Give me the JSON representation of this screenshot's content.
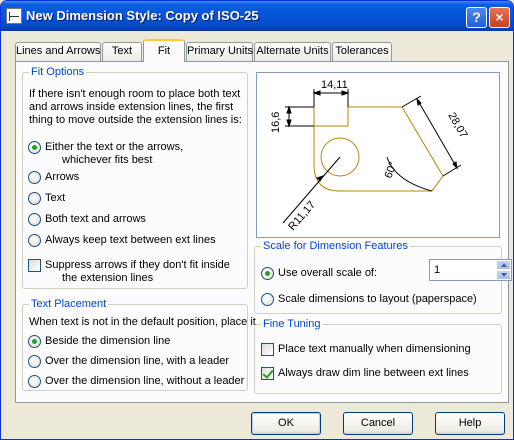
{
  "window": {
    "title": "New Dimension Style: Copy of ISO-25",
    "help_glyph": "?",
    "close_glyph": "×"
  },
  "tabs": [
    {
      "label": "Lines and Arrows"
    },
    {
      "label": "Text"
    },
    {
      "label": "Fit",
      "active": true
    },
    {
      "label": "Primary Units"
    },
    {
      "label": "Alternate Units"
    },
    {
      "label": "Tolerances"
    }
  ],
  "fit_options": {
    "title": "Fit Options",
    "description": [
      "If there isn't enough room to place both text",
      "and arrows inside extension lines, the first",
      "thing to move outside the extension lines is:"
    ],
    "either_label_1": "Either the text or the arrows,",
    "either_label_2": "whichever fits best",
    "arrows_label": "Arrows",
    "text_label": "Text",
    "both_label": "Both text and arrows",
    "always_keep_label": "Always keep text between ext lines",
    "suppress_label_1": "Suppress arrows if they don't fit inside",
    "suppress_label_2": "the extension lines",
    "selected": "either"
  },
  "text_placement": {
    "title": "Text Placement",
    "description": "When text is not in the default position, place it",
    "beside_label": "Beside the dimension line",
    "over_leader_label": "Over the dimension line, with a leader",
    "over_no_leader_label": "Over the dimension line, without a leader",
    "selected": "beside"
  },
  "preview": {
    "dim_top": "14,11",
    "dim_left": "16,6",
    "dim_right": "28,07",
    "dim_angle": "60°",
    "dim_radius": "R11,17",
    "geometry_color": "#b8860b"
  },
  "scale": {
    "title": "Scale for Dimension Features",
    "use_overall_label": "Use overall scale of:",
    "overall_value": "1",
    "scale_to_layout_label": "Scale dimensions to layout (paperspace)",
    "selected": "overall"
  },
  "fine_tuning": {
    "title": "Fine Tuning",
    "place_manual_label": "Place text manually when dimensioning",
    "place_manual_checked": false,
    "always_draw_label": "Always draw dim line between ext lines",
    "always_draw_checked": true
  },
  "buttons": {
    "ok": "OK",
    "cancel": "Cancel",
    "help": "Help"
  },
  "colors": {
    "title_bar": "#0555d8",
    "group_title": "#0046d5",
    "radio_dot": "#21a121"
  }
}
